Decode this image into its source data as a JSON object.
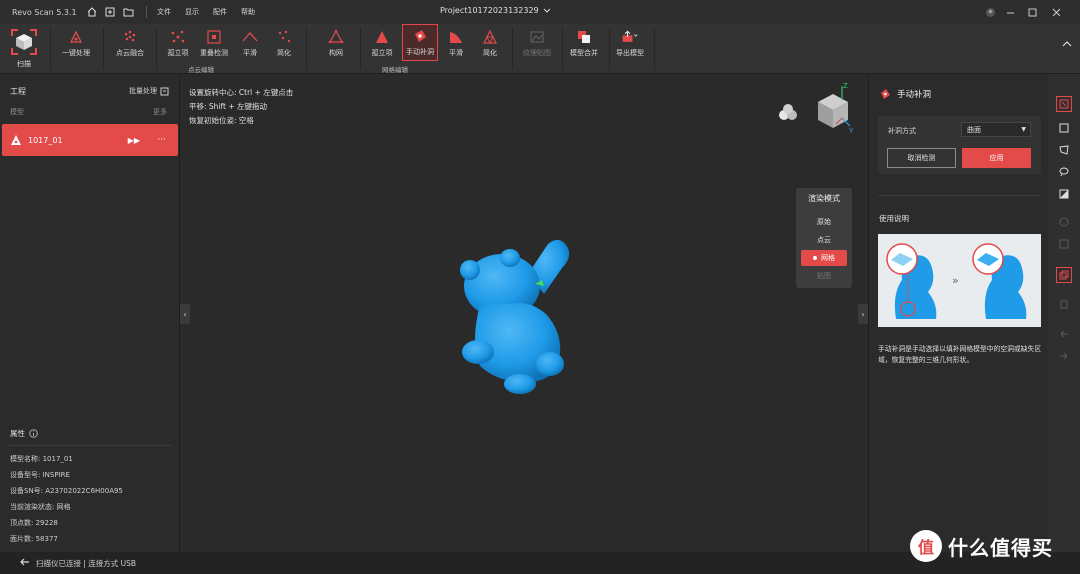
{
  "titlebar": {
    "app_title": "Revo Scan 5.3.1",
    "menus": [
      "文件",
      "显示",
      "配件",
      "帮助"
    ],
    "project_title": "Project10172023132329",
    "icons": [
      "home-icon",
      "add-icon",
      "folder-icon"
    ]
  },
  "toolbar": {
    "scan": "扫描",
    "one_click": "一键处理",
    "pointcloud_fuse": "点云融合",
    "isolated": "孤立项",
    "overlap": "重叠检测",
    "smooth1": "平滑",
    "simplify1": "简化",
    "mesh": "构网",
    "isolated2": "孤立项",
    "manual_fill": "手动补洞",
    "smooth2": "平滑",
    "simplify2": "简化",
    "texture": "纹理贴图",
    "merge": "模型合并",
    "export": "导出模型",
    "group_pointcloud": "点云编辑",
    "group_mesh": "网格编辑"
  },
  "left": {
    "project": "工程",
    "batch": "批量处理",
    "model_col": "模型",
    "more_col": "更多",
    "model_name": "1017_01",
    "properties_title": "属性",
    "properties": [
      "模型名称:  1017_01",
      "设备型号:  INSPIRE",
      "设备SN号:  A23702022C6H00A95",
      "当前渲染状态:  网格",
      "顶点数:  29228",
      "面片数:  58377"
    ]
  },
  "viewport": {
    "hints": [
      "设置旋转中心: Ctrl + 左键点击",
      "平移: Shift + 左键拖动",
      "恢复初始位姿: 空格"
    ],
    "render_mode": {
      "title": "渲染模式",
      "options": [
        "原始",
        "点云",
        "网格",
        "贴图"
      ],
      "selected": "网格"
    }
  },
  "right": {
    "title": "手动补洞",
    "fill_method_label": "补洞方式",
    "fill_method_value": "曲面",
    "cancel_btn": "取消检测",
    "apply_btn": "应用",
    "usage_title": "使用说明",
    "usage_desc": "手动补洞是手动选择以填补网格模型中的空洞或缺失区域，恢复完整的三维几何形状。"
  },
  "status": {
    "text": "扫描仪已连接 | 连接方式 USB"
  },
  "watermark": {
    "text": "什么值得买",
    "logo": "值"
  },
  "colors": {
    "accent": "#e34a4a",
    "model_blue": "#1f9be8",
    "bg": "#2a2a2a"
  }
}
